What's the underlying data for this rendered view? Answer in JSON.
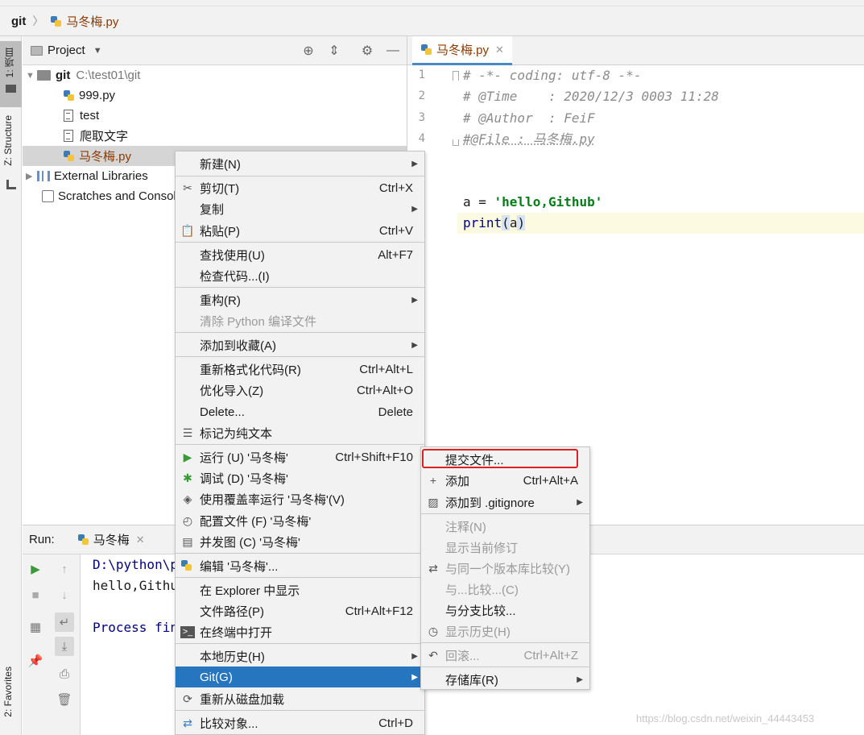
{
  "navbar": {
    "root": "git",
    "file": "马冬梅.py"
  },
  "left_tools": {
    "project_tab": "1: 项目",
    "structure_tab": "Z: Structure",
    "favorites_tab": "2: Favorites"
  },
  "project_panel": {
    "title": "Project",
    "tree": [
      {
        "label": "git",
        "path": "C:\\test01\\git"
      },
      {
        "label": "999.py"
      },
      {
        "label": "test"
      },
      {
        "label": "爬取文字"
      },
      {
        "label": "马冬梅.py"
      },
      {
        "label": "External Libraries"
      },
      {
        "label": "Scratches and Consoles"
      }
    ]
  },
  "editor": {
    "tab": "马冬梅.py",
    "line_numbers": [
      "1",
      "2",
      "3",
      "4"
    ],
    "lines": [
      "# -*- coding: utf-8 -*-",
      "# @Time    : 2020/12/3 0003 11:28",
      "# @Author  : FeiF",
      "#@File : 马冬梅.py"
    ],
    "code_a_prefix": "a = ",
    "code_a_str": "'hello,Github'",
    "code_print_fn": "print",
    "code_print_open": "(",
    "code_print_arg": "a",
    "code_print_close": ")"
  },
  "run_panel": {
    "label": "Run:",
    "tab": "马冬梅",
    "console": [
      "D:\\python\\p",
      "hello,Githu",
      "",
      "Process fin"
    ]
  },
  "context_menu": {
    "items": [
      {
        "label": "新建(N)"
      },
      {
        "label": "剪切(T)",
        "shortcut": "Ctrl+X"
      },
      {
        "label": "复制"
      },
      {
        "label": "粘贴(P)",
        "shortcut": "Ctrl+V"
      },
      {
        "label": "查找使用(U)",
        "shortcut": "Alt+F7"
      },
      {
        "label": "检查代码...(I)"
      },
      {
        "label": "重构(R)"
      },
      {
        "label": "清除 Python 编译文件"
      },
      {
        "label": "添加到收藏(A)"
      },
      {
        "label": "重新格式化代码(R)",
        "shortcut": "Ctrl+Alt+L"
      },
      {
        "label": "优化导入(Z)",
        "shortcut": "Ctrl+Alt+O"
      },
      {
        "label": "Delete...",
        "shortcut": "Delete"
      },
      {
        "label": "标记为纯文本"
      },
      {
        "label": "运行 (U) '马冬梅'",
        "shortcut": "Ctrl+Shift+F10"
      },
      {
        "label": "调试 (D) '马冬梅'"
      },
      {
        "label": "使用覆盖率运行 '马冬梅'(V)"
      },
      {
        "label": "配置文件 (F) '马冬梅'"
      },
      {
        "label": "并发图 (C) '马冬梅'"
      },
      {
        "label": "编辑 '马冬梅'..."
      },
      {
        "label": "在 Explorer 中显示"
      },
      {
        "label": "文件路径(P)",
        "shortcut": "Ctrl+Alt+F12"
      },
      {
        "label": "在终端中打开"
      },
      {
        "label": "本地历史(H)"
      },
      {
        "label": "Git(G)"
      },
      {
        "label": "重新从磁盘加载"
      },
      {
        "label": "比较对象...",
        "shortcut": "Ctrl+D"
      }
    ]
  },
  "git_submenu": {
    "items": [
      {
        "label": "提交文件..."
      },
      {
        "label": "添加",
        "shortcut": "Ctrl+Alt+A"
      },
      {
        "label": "添加到 .gitignore"
      },
      {
        "label": "注释(N)"
      },
      {
        "label": "显示当前修订"
      },
      {
        "label": "与同一个版本库比较(Y)"
      },
      {
        "label": "与...比较...(C)"
      },
      {
        "label": "与分支比较..."
      },
      {
        "label": "显示历史(H)"
      },
      {
        "label": "回滚...",
        "shortcut": "Ctrl+Alt+Z"
      },
      {
        "label": "存储库(R)"
      }
    ]
  },
  "watermark": "https://blog.csdn.net/weixin_44443453",
  "colors": {
    "highlight": "#2675bf",
    "annotation_box": "#e02020",
    "string": "#067d17"
  }
}
